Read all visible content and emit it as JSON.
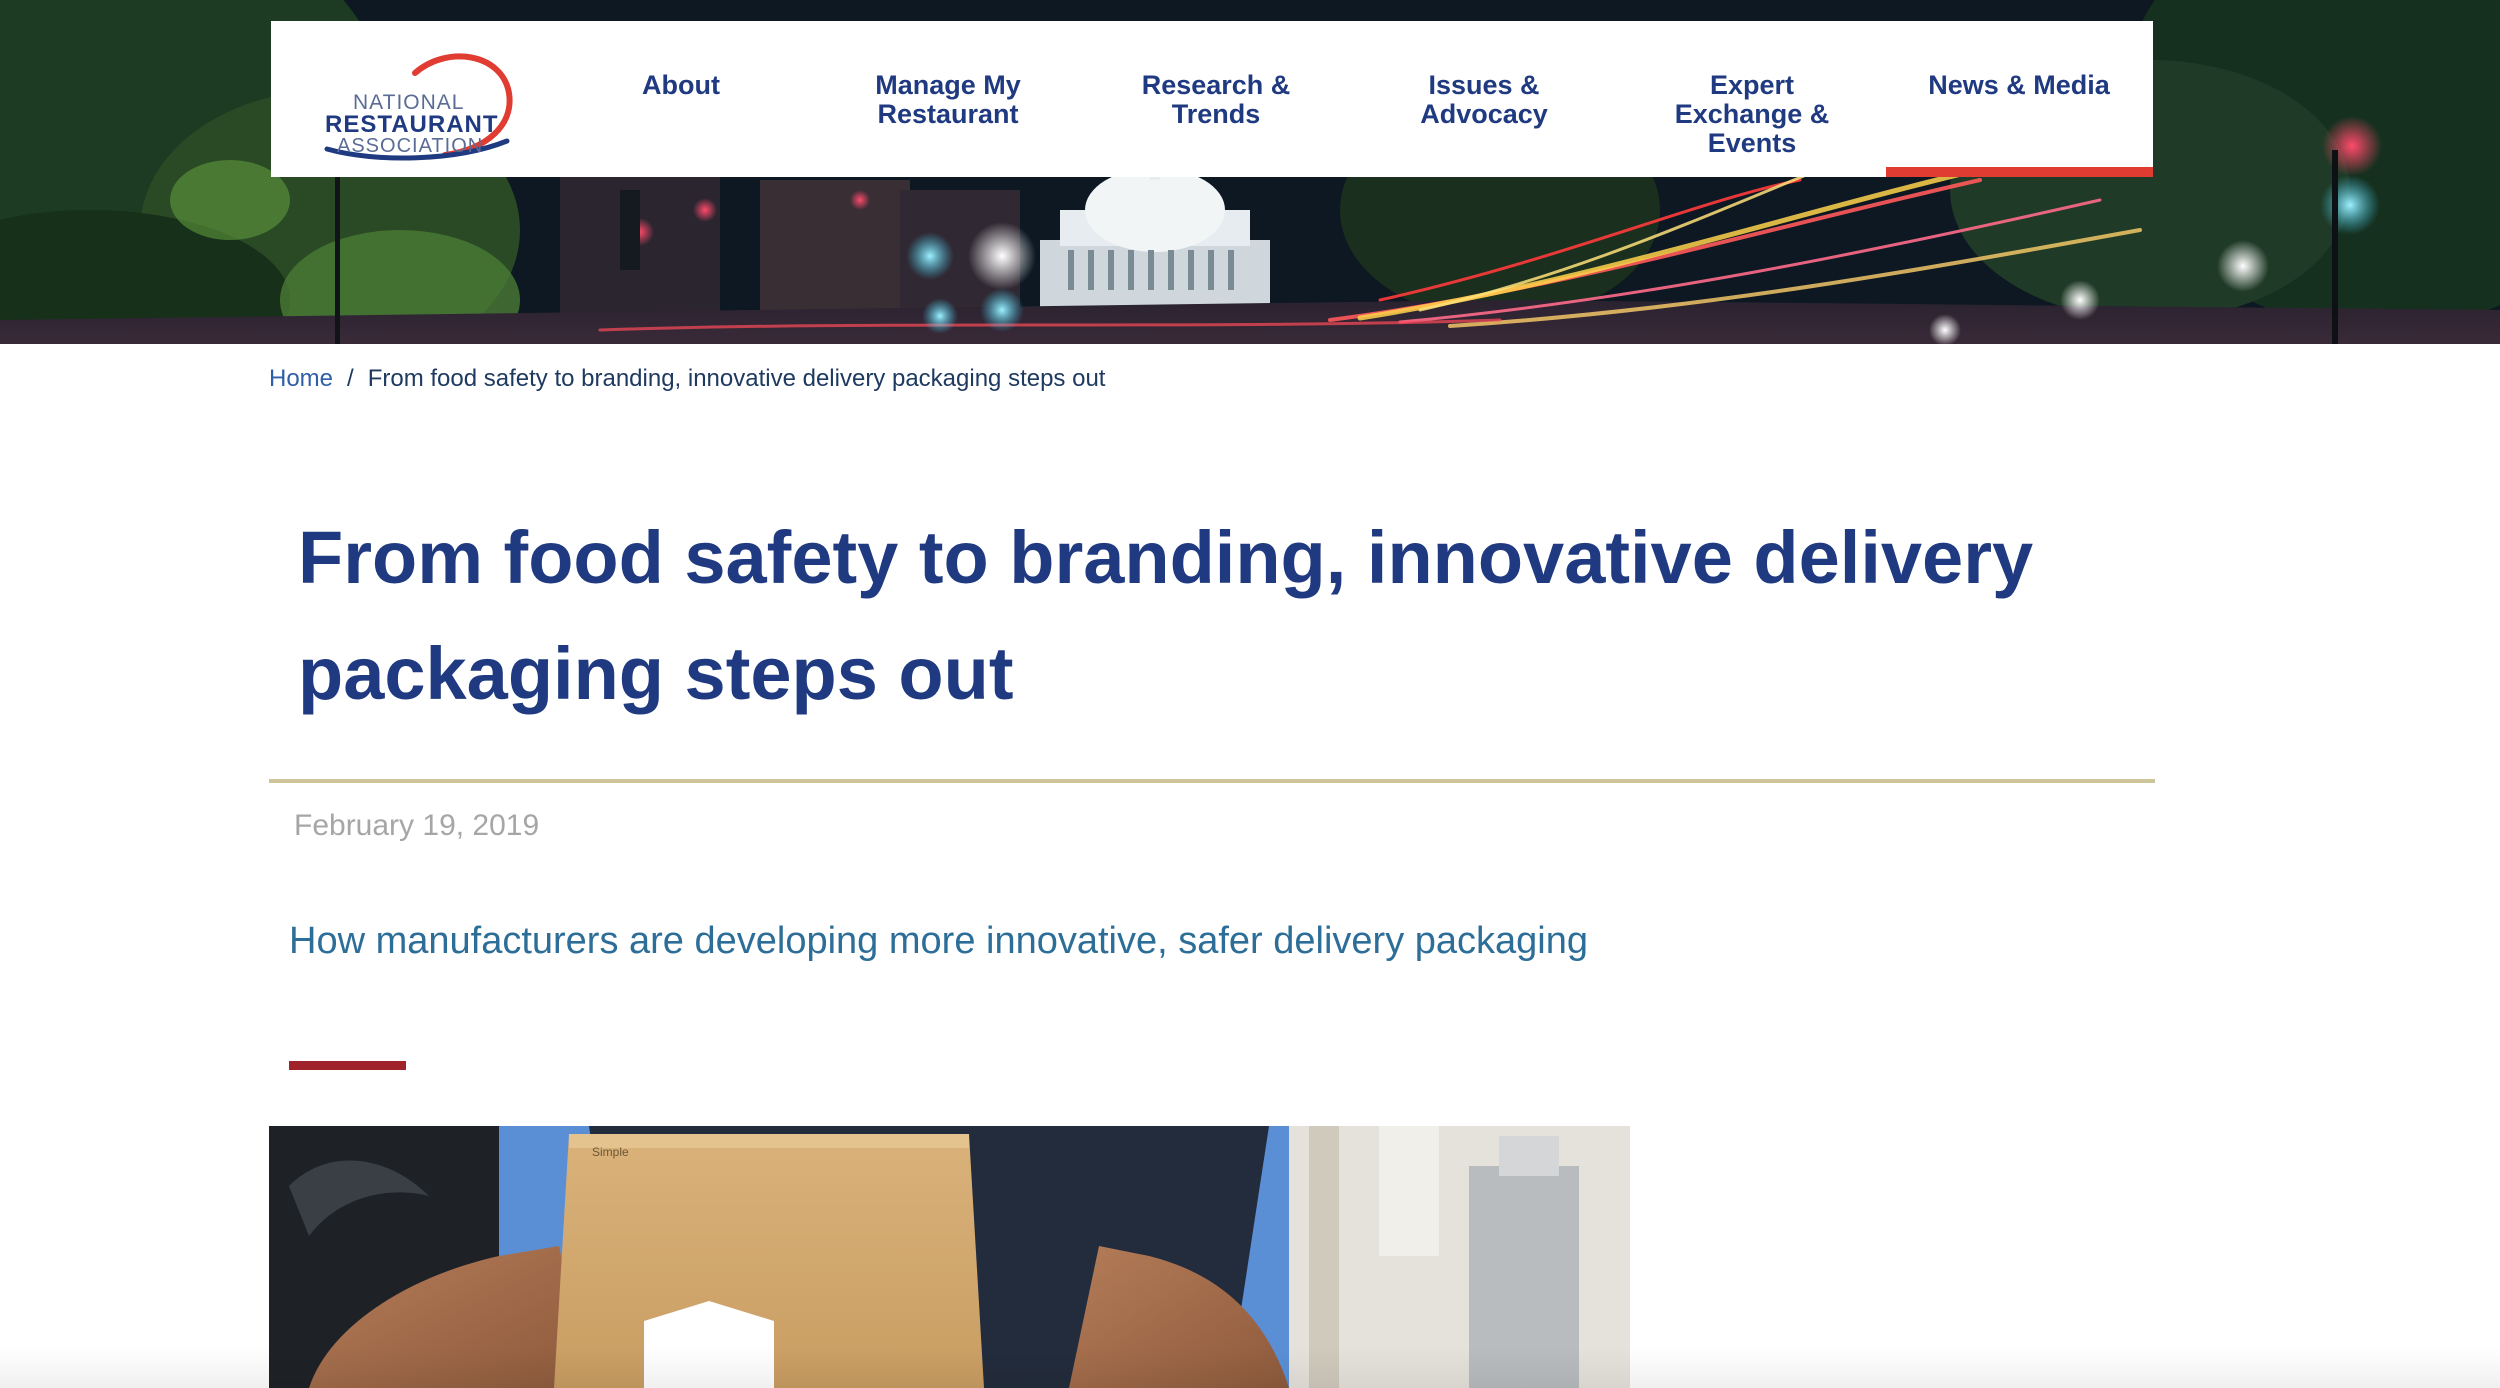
{
  "logo": {
    "line1": "NATIONAL",
    "line2": "RESTAURANT",
    "line3": "ASSOCIATION",
    "brand_red": "#e03c31",
    "brand_blue": "#1f3a80"
  },
  "nav": {
    "items": [
      {
        "label": "About"
      },
      {
        "label": "Manage My\nRestaurant"
      },
      {
        "label": "Research &\nTrends"
      },
      {
        "label": "Issues &\nAdvocacy"
      },
      {
        "label": "Expert\nExchange &\nEvents"
      },
      {
        "label": "News & Media",
        "active": true
      }
    ],
    "active_color": "#e03c31"
  },
  "breadcrumb": {
    "home": "Home",
    "separator": "/",
    "current": "From food safety to branding, innovative delivery packaging steps out"
  },
  "article": {
    "title": "From food safety to branding, innovative delivery packaging steps out",
    "date": "February 19, 2019",
    "subtitle": "How manufacturers are developing more innovative, safer delivery packaging",
    "image_bag_text": "Simple",
    "title_color": "#1f3a80",
    "subtitle_color": "#2d6e98",
    "rule_color": "#cfc59a",
    "accent_rule_color": "#a0232c"
  }
}
